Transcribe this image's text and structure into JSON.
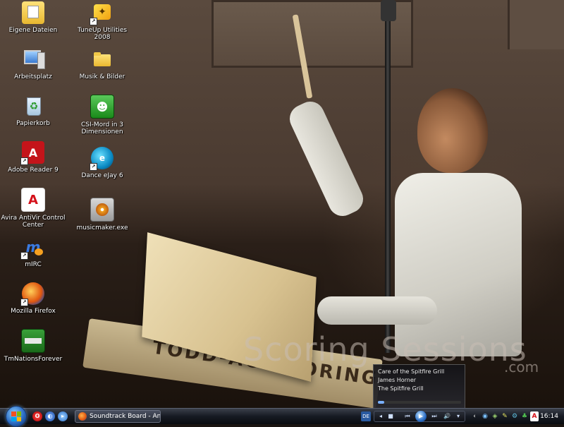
{
  "desktop": {
    "icons": [
      {
        "label": "Eigene Dateien",
        "icon": "folder-documents-icon"
      },
      {
        "label": "Arbeitsplatz",
        "icon": "computer-icon"
      },
      {
        "label": "Papierkorb",
        "icon": "recycle-bin-icon"
      },
      {
        "label": "Adobe Reader 9",
        "icon": "adobe-reader-icon"
      },
      {
        "label": "Avira AntiVir Control Center",
        "icon": "avira-icon"
      },
      {
        "label": "mIRC",
        "icon": "mirc-icon"
      },
      {
        "label": "Mozilla Firefox",
        "icon": "firefox-icon"
      },
      {
        "label": "TmNationsForever",
        "icon": "tmnations-icon"
      },
      {
        "label": "TuneUp Utilities 2008",
        "icon": "tuneup-icon"
      },
      {
        "label": "Musik & Bilder",
        "icon": "folder-icon"
      },
      {
        "label": "CSI-Mord in 3 Dimensionen",
        "icon": "csi-game-icon"
      },
      {
        "label": "Dance eJay 6",
        "icon": "dance-ejay-icon"
      },
      {
        "label": "musicmaker.exe",
        "icon": "musicmaker-icon"
      }
    ]
  },
  "wallpaper": {
    "desk_text": "TODD-AO SCORING",
    "watermark": "Scoring Sessions",
    "watermark_suffix": ".com"
  },
  "media_notification": {
    "track": "Care of the Spitfire Grill",
    "artist": "James Horner",
    "album": "The Spitfire Grill",
    "progress": 0.08
  },
  "taskbar": {
    "active_window": "Soundtrack Board - An...",
    "tray_lang": "DE",
    "clock": "16:14"
  },
  "colors": {
    "accent": "#2b6cc4",
    "taskbar": "#161a22"
  }
}
